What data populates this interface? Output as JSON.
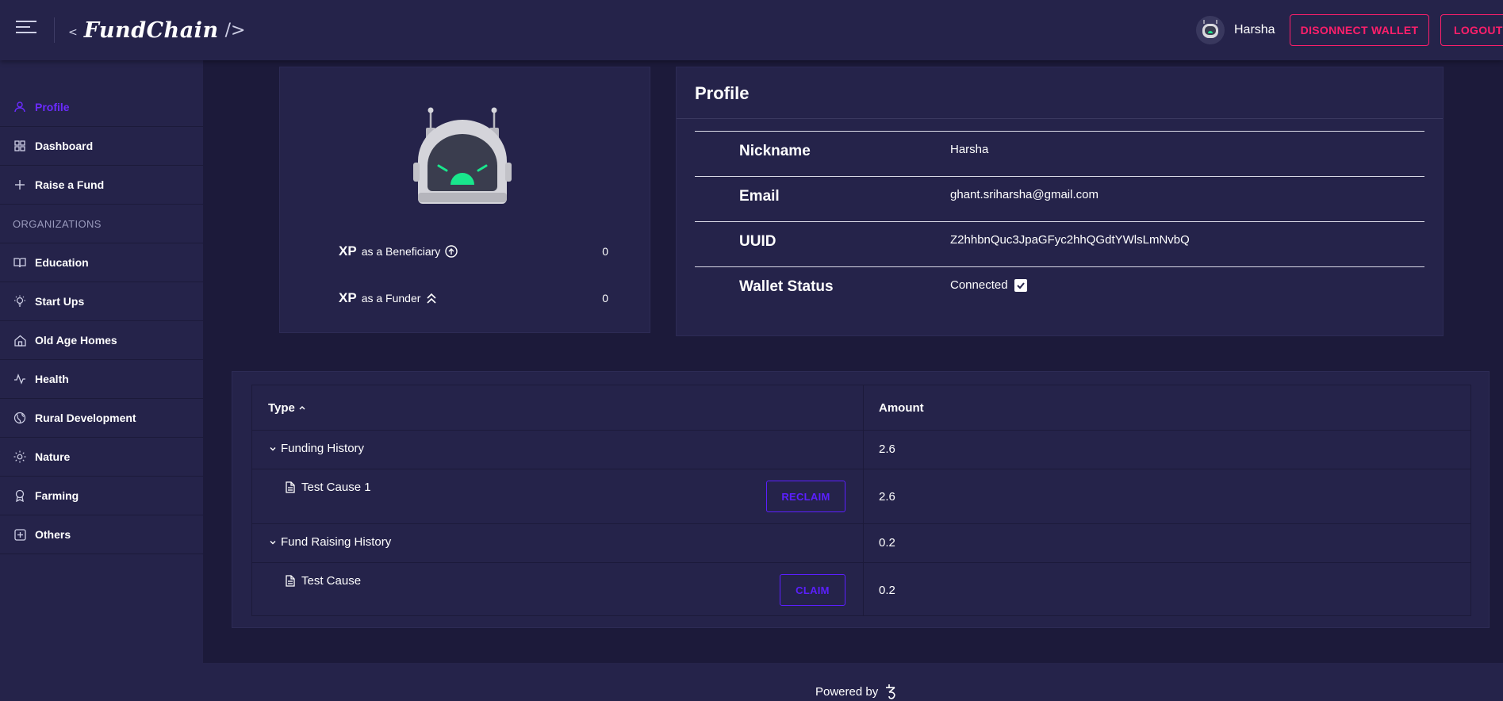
{
  "header": {
    "brand_open": "<",
    "brand_name": "FundChain",
    "brand_close": "/>",
    "user_name": "Harsha",
    "disconnect_label": "DISONNECT WALLET",
    "logout_label": "LOGOUT"
  },
  "sidebar": {
    "items": [
      {
        "label": "Profile",
        "icon": "user-icon"
      },
      {
        "label": "Dashboard",
        "icon": "grid-icon"
      },
      {
        "label": "Raise a Fund",
        "icon": "plus-icon"
      }
    ],
    "section_label": "ORGANIZATIONS",
    "orgs": [
      {
        "label": "Education",
        "icon": "book-icon"
      },
      {
        "label": "Start Ups",
        "icon": "bulb-icon"
      },
      {
        "label": "Old Age Homes",
        "icon": "home-icon"
      },
      {
        "label": "Health",
        "icon": "activity-icon"
      },
      {
        "label": "Rural Development",
        "icon": "globe-icon"
      },
      {
        "label": "Nature",
        "icon": "sun-icon"
      },
      {
        "label": "Farming",
        "icon": "award-icon"
      },
      {
        "label": "Others",
        "icon": "plus-square-icon"
      }
    ]
  },
  "xp": {
    "xp_word": "XP",
    "beneficiary_label": "as a Beneficiary",
    "beneficiary_value": "0",
    "funder_label": "as a Funder",
    "funder_value": "0"
  },
  "profile": {
    "title": "Profile",
    "nickname_key": "Nickname",
    "nickname_value": "Harsha",
    "email_key": "Email",
    "email_value": "ghant.sriharsha@gmail.com",
    "uuid_key": "UUID",
    "uuid_value": "Z2hhbnQuc3JpaGFyc2hhQGdtYWlsLmNvbQ",
    "wallet_key": "Wallet Status",
    "wallet_value": "Connected"
  },
  "table": {
    "col_type": "Type",
    "col_amount": "Amount",
    "groups": [
      {
        "label": "Funding History",
        "amount": "2.6",
        "item": "Test Cause 1",
        "item_amount": "2.6",
        "action": "RECLAIM"
      },
      {
        "label": "Fund Raising History",
        "amount": "0.2",
        "item": "Test Cause",
        "item_amount": "0.2",
        "action": "CLAIM"
      }
    ]
  },
  "footer": {
    "powered_by": "Powered by",
    "logo": "tezos-icon"
  },
  "colors": {
    "background": "#1c1a3a",
    "panel": "#25234a",
    "accent_pink": "#ff1f6b",
    "accent_purple": "#5b1fff",
    "active_nav": "#6b2bff",
    "robot_eye": "#19e68c"
  }
}
